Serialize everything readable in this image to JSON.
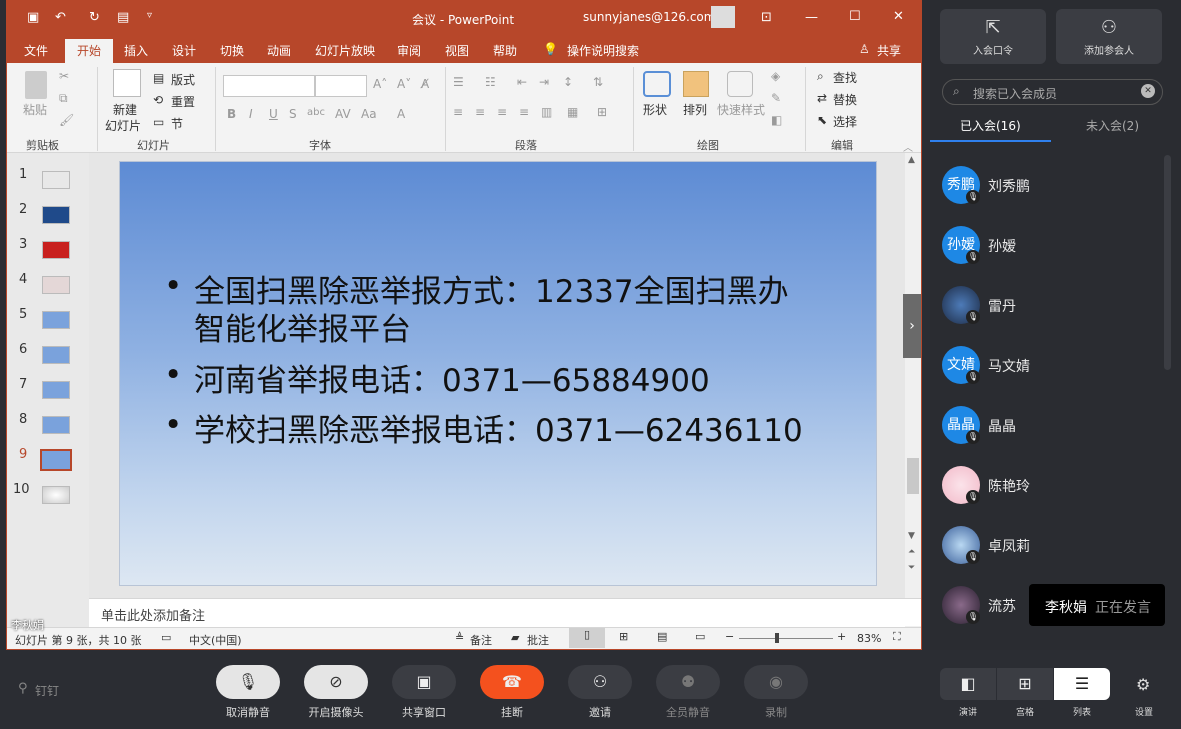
{
  "ppt": {
    "title": "会议  -  PowerPoint",
    "account": "sunnyjanes@126.com",
    "tabs": [
      "文件",
      "开始",
      "插入",
      "设计",
      "切换",
      "动画",
      "幻灯片放映",
      "审阅",
      "视图",
      "帮助"
    ],
    "tell_me": "操作说明搜索",
    "share": "共享",
    "ribbon": {
      "clipboard": {
        "paste": "粘贴",
        "group": "剪贴板"
      },
      "slides": {
        "new_slide": "新建",
        "new_slide2": "幻灯片",
        "layout": "版式",
        "reset": "重置",
        "section": "节",
        "group": "幻灯片"
      },
      "font": {
        "group": "字体"
      },
      "paragraph": {
        "group": "段落"
      },
      "drawing": {
        "shape": "形状",
        "arrange": "排列",
        "quick_styles": "快速样式",
        "group": "绘图"
      },
      "editing": {
        "find": "查找",
        "replace": "替换",
        "select": "选择",
        "group": "编辑"
      }
    },
    "thumb_numbers": [
      "1",
      "2",
      "3",
      "4",
      "5",
      "6",
      "7",
      "8",
      "9",
      "10"
    ],
    "current_slide": "9",
    "slide_bullets": [
      "全国扫黑除恶举报方式：12337全国扫黑办",
      "智能化举报平台",
      "河南省举报电话：0371—65884900",
      "学校扫黑除恶举报电话：0371—62436110"
    ],
    "notes_placeholder": "单击此处添加备注",
    "status": {
      "slide_count": "幻灯片 第 9 张，共 10 张",
      "language": "中文(中国)",
      "notes": "备注",
      "comments": "批注",
      "zoom": "83%"
    },
    "overlay_name": "李秋娟"
  },
  "panel": {
    "join_code": "入会口令",
    "add_member": "添加参会人",
    "search_placeholder": "搜索已入会成员",
    "tab_joined": "已入会(16)",
    "tab_not_joined": "未入会(2)",
    "members": [
      {
        "avatar": "秀鹏",
        "name": "刘秀鹏"
      },
      {
        "avatar": "孙嫒",
        "name": "孙嫒"
      },
      {
        "avatar": "",
        "name": "雷丹"
      },
      {
        "avatar": "文婧",
        "name": "马文婧"
      },
      {
        "avatar": "晶晶",
        "name": "晶晶"
      },
      {
        "avatar": "",
        "name": "陈艳玲"
      },
      {
        "avatar": "",
        "name": "卓凤莉"
      },
      {
        "avatar": "",
        "name": "流苏"
      }
    ],
    "speaker_name": "李秋娟",
    "speaker_status": "正在发言"
  },
  "controls": {
    "brand": "钉钉",
    "buttons": [
      "取消静音",
      "开启摄像头",
      "共享窗口",
      "挂断",
      "邀请",
      "全员静音",
      "录制"
    ],
    "views": [
      "演讲",
      "宫格",
      "列表"
    ],
    "settings": "设置"
  },
  "colors": {
    "ppt_accent": "#b7472a",
    "hangup": "#f4511e",
    "avatar_blue": "#1e88e5"
  }
}
